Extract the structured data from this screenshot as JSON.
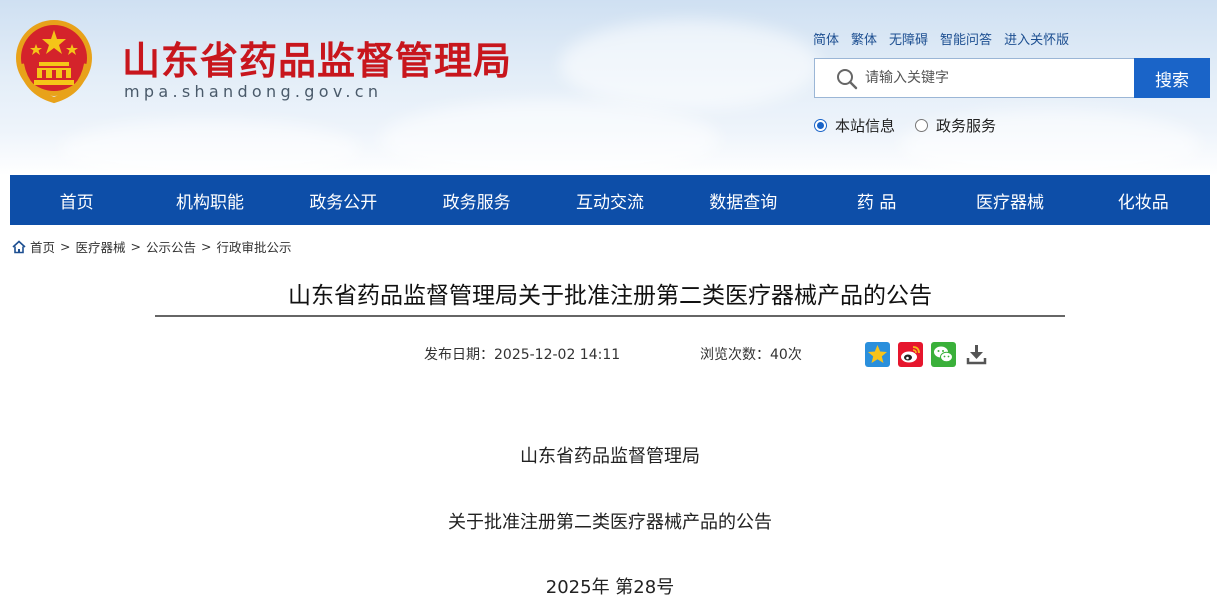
{
  "header": {
    "site_title": "山东省药品监督管理局",
    "site_domain": "mpa.shandong.gov.cn",
    "top_links": [
      "简体",
      "繁体",
      "无障碍",
      "智能问答",
      "进入关怀版"
    ],
    "search": {
      "placeholder": "请输入关键字",
      "button_label": "搜索"
    },
    "search_scope": [
      {
        "label": "本站信息",
        "checked": true
      },
      {
        "label": "政务服务",
        "checked": false
      }
    ]
  },
  "nav": {
    "items": [
      "首页",
      "机构职能",
      "政务公开",
      "政务服务",
      "互动交流",
      "数据查询",
      "药 品",
      "医疗器械",
      "化妆品"
    ]
  },
  "breadcrumb": {
    "items": [
      "首页",
      "医疗器械",
      "公示公告",
      "行政审批公示"
    ],
    "separator": ">"
  },
  "article": {
    "title": "山东省药品监督管理局关于批准注册第二类医疗器械产品的公告",
    "publish_date": "发布日期：2025-12-02 14:11",
    "views": "浏览次数：40次",
    "body": [
      "山东省药品监督管理局",
      "关于批准注册第二类医疗器械产品的公告",
      "2025年  第28号"
    ]
  },
  "icons": {
    "emblem": "national-emblem-icon",
    "search": "search-icon",
    "home": "home-icon",
    "share": [
      "favorite-star-icon",
      "weibo-icon",
      "wechat-icon",
      "download-icon"
    ]
  },
  "colors": {
    "brand_red": "#c8161d",
    "nav_blue": "#0d4ea8",
    "search_blue": "#1a64c8",
    "link_blue": "#1d4f91"
  }
}
